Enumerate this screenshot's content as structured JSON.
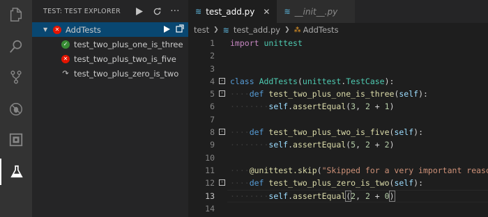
{
  "sidebar": {
    "title": "TEST: TEST EXPLORER",
    "suite": {
      "label": "AddTests",
      "status": "fail"
    },
    "tests": [
      {
        "label": "test_two_plus_one_is_three",
        "status": "pass"
      },
      {
        "label": "test_two_plus_two_is_five",
        "status": "fail"
      },
      {
        "label": "test_two_plus_zero_is_two",
        "status": "skip"
      }
    ]
  },
  "tabs": [
    {
      "label": "test_add.py",
      "active": true
    },
    {
      "label": "__init__.py",
      "active": false
    }
  ],
  "breadcrumb": [
    "test",
    "test_add.py",
    "AddTests"
  ],
  "code": {
    "line_numbers": [
      "1",
      "2",
      "3",
      "4",
      "5",
      "6",
      "7",
      "8",
      "9",
      "10",
      "11",
      "12",
      "13",
      "14"
    ],
    "l1": [
      "import",
      "unittest"
    ],
    "l4": [
      "class",
      "AddTests",
      "unittest",
      "TestCase"
    ],
    "l5": [
      "def",
      "test_two_plus_one_is_three",
      "self"
    ],
    "l6": [
      "self",
      "assertEqual",
      "3",
      "2",
      "1"
    ],
    "l8": [
      "def",
      "test_two_plus_two_is_five",
      "self"
    ],
    "l9": [
      "self",
      "assertEqual",
      "5",
      "2",
      "2"
    ],
    "l11": [
      "@unittest.skip",
      "\"Skipped for a very important reason\""
    ],
    "l12": [
      "def",
      "test_two_plus_zero_is_two",
      "self"
    ],
    "l13": [
      "self",
      "assertEqual",
      "2",
      "2",
      "0"
    ]
  },
  "colors": {
    "activity_bar": "#333333",
    "sidebar": "#252526",
    "editor": "#1e1e1e",
    "selection": "#094771",
    "fail": "#e51400",
    "pass": "#388a34"
  }
}
